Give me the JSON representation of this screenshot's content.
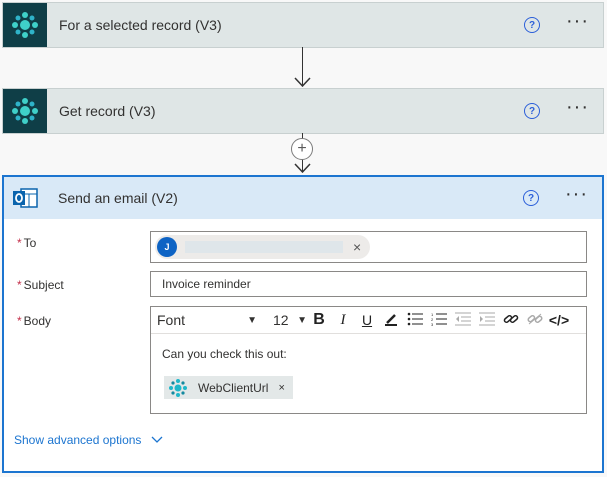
{
  "steps": [
    {
      "title": "For a selected record (V3)"
    },
    {
      "title": "Get record (V3)"
    }
  ],
  "email": {
    "title": "Send an email (V2)",
    "to_label": "To",
    "to_avatar": "J",
    "subject_label": "Subject",
    "subject_value": "Invoice reminder",
    "body_label": "Body",
    "font_value": "Font",
    "font_size": "12",
    "body_text": "Can you check this out:",
    "dynamic_token": "WebClientUrl",
    "advanced_link": "Show advanced options"
  },
  "glyphs": {
    "help": "?",
    "more": "···",
    "plus": "+",
    "remove": "×",
    "required": "*"
  },
  "colors": {
    "accent": "#1c75d0",
    "app_icon_bg": "#0f3e47",
    "required": "#c4314b"
  }
}
